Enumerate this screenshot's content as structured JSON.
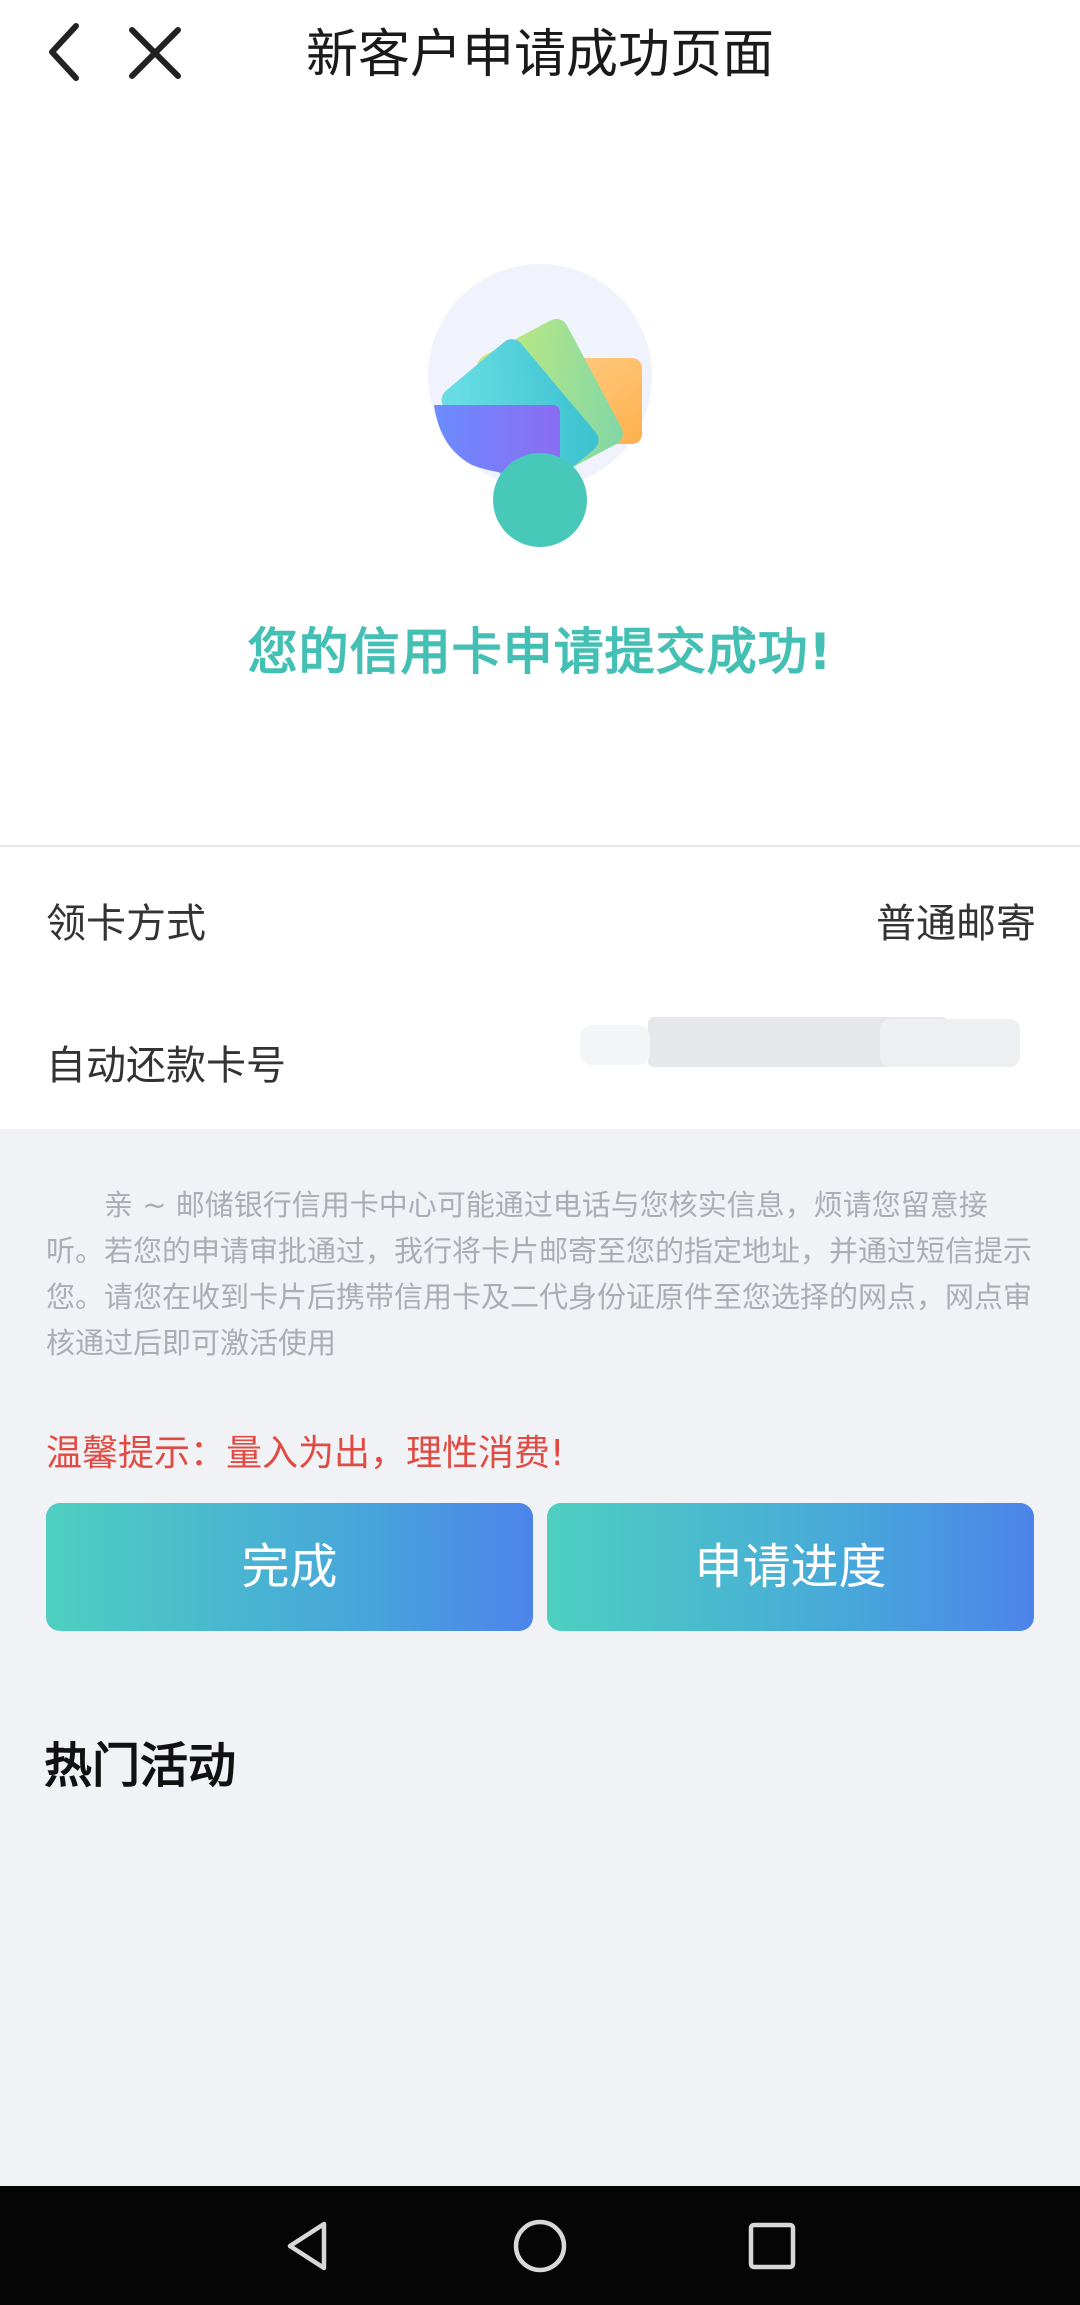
{
  "header": {
    "title": "新客户申请成功页面",
    "back_icon": "chevron-left-icon",
    "close_icon": "close-icon"
  },
  "hero": {
    "illustration": "credit-cards-illustration",
    "message": "您的信用卡申请提交成功!"
  },
  "info": {
    "rows": [
      {
        "label": "领卡方式",
        "value": "普通邮寄"
      },
      {
        "label": "自动还款卡号",
        "value_masked": true
      }
    ]
  },
  "notice": {
    "text": "亲 ~ 邮储银行信用卡中心可能通过电话与您核实信息，烦请您留意接听。若您的申请审批通过，我行将卡片邮寄至您的指定地址，并通过短信提示您。请您在收到卡片后携带信用卡及二代身份证原件至您选择的网点，网点审核通过后即可激活使用",
    "tip": "温馨提示：量入为出，理性消费!"
  },
  "actions": {
    "done_label": "完成",
    "progress_label": "申请进度"
  },
  "section": {
    "title": "热门活动"
  },
  "system_nav": {
    "back_icon": "triangle-back-icon",
    "home_icon": "circle-home-icon",
    "recents_icon": "square-recents-icon"
  },
  "colors": {
    "accent": "#43bfb3",
    "tip": "#e04b44",
    "button_gradient_start": "#4ecfc0",
    "button_gradient_end": "#4c84ea"
  }
}
